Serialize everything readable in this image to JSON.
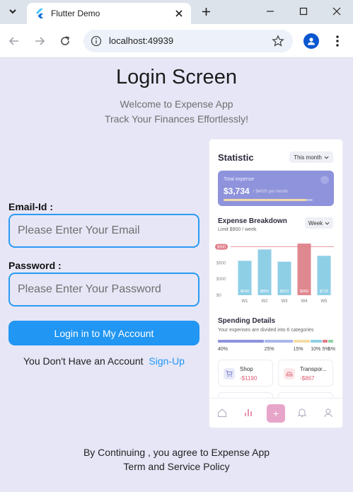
{
  "browser": {
    "tab_title": "Flutter Demo",
    "url": "localhost:49939"
  },
  "page": {
    "title": "Login Screen",
    "welcome": "Welcome to Expense App",
    "tagline": "Track Your Finances Effortlessly!",
    "email_label": "Email-Id :",
    "email_placeholder": "Please Enter Your Email",
    "password_label": "Password :",
    "password_placeholder": "Please Enter Your Password",
    "login_button": "Login in to My Account",
    "no_account_text": "You Don't Have an Account",
    "signup_link": "Sign-Up",
    "footer_line1": "By Continuing , you agree to Expense App",
    "footer_line2": "Term and Service Policy"
  },
  "dashboard": {
    "title": "Statistic",
    "period": "This month",
    "total_label": "Total expense",
    "total_amount": "$3,734",
    "total_sub": "/ $4000 per month",
    "total_progress": 0.93,
    "breakdown_title": "Expense Breakdown",
    "breakdown_limit": "Limit $900 / week",
    "breakdown_period": "Week",
    "spending_title": "Spending Details",
    "spending_sub": "Your expenses are divided into 6 categories",
    "segments": [
      {
        "pct": "40%",
        "value": 40,
        "color": "#8e93dc"
      },
      {
        "pct": "25%",
        "value": 25,
        "color": "#a9b6ea"
      },
      {
        "pct": "15%",
        "value": 15,
        "color": "#f3dca6"
      },
      {
        "pct": "10%",
        "value": 10,
        "color": "#8fd0e6"
      },
      {
        "pct": "5%",
        "value": 5,
        "color": "#e07a86"
      },
      {
        "pct": "5%",
        "value": 5,
        "color": "#8fd3a6"
      }
    ],
    "categories": [
      {
        "name": "Shop",
        "amount": "-$1190",
        "icon": "cart-icon",
        "bg": "#e8eaf8",
        "fg": "#7a80d0"
      },
      {
        "name": "Transpor...",
        "amount": "-$867",
        "icon": "car-icon",
        "bg": "#fbe8ea",
        "fg": "#e07a86"
      }
    ]
  },
  "chart_data": {
    "type": "bar",
    "categories": [
      "W1",
      "W2",
      "W3",
      "W4",
      "W5"
    ],
    "values": [
      640,
      850,
      623,
      960,
      732
    ],
    "value_labels": [
      "$640",
      "$850",
      "$623",
      "$960",
      "$732"
    ],
    "limit": 900,
    "limit_label": "$900",
    "yticks": [
      0,
      300,
      600
    ],
    "ytick_labels": [
      "$0",
      "$300",
      "$600"
    ],
    "ylim": [
      0,
      1000
    ],
    "colors": {
      "normal": "#8fcfe6",
      "over": "#e08890",
      "limit": "#e07a86"
    },
    "title": "Expense Breakdown"
  }
}
